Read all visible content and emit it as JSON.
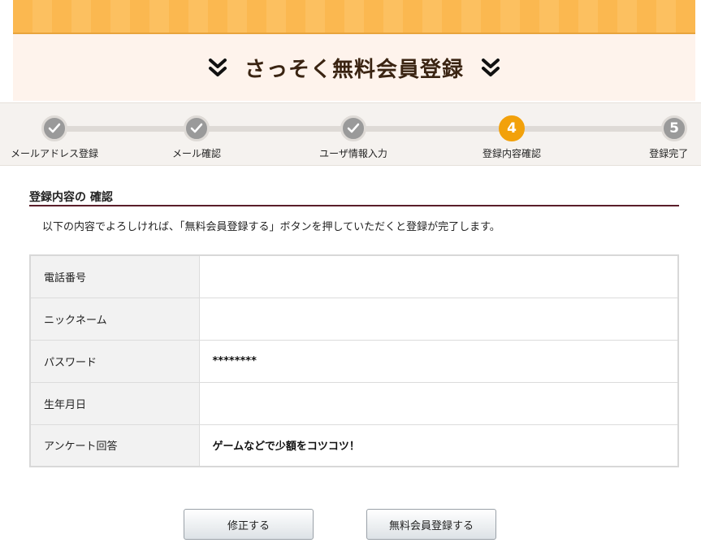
{
  "header": {
    "title": "さっそく無料会員登録",
    "chevron_icon": "double-chevron-down-icon"
  },
  "steps": [
    {
      "number": "1",
      "label": "メールアドレス登録",
      "state": "done"
    },
    {
      "number": "2",
      "label": "メール確認",
      "state": "done"
    },
    {
      "number": "3",
      "label": "ユーザ情報入力",
      "state": "done"
    },
    {
      "number": "4",
      "label": "登録内容確認",
      "state": "current"
    },
    {
      "number": "5",
      "label": "登録完了",
      "state": "todo"
    }
  ],
  "section": {
    "heading": "登録内容の 確認",
    "intro": "以下の内容でよろしければ、「無料会員登録する」ボタンを押していただくと登録が完了します。"
  },
  "table": {
    "rows": [
      {
        "label": "電話番号",
        "value": ""
      },
      {
        "label": "ニックネーム",
        "value": ""
      },
      {
        "label": "パスワード",
        "value": "********"
      },
      {
        "label": "生年月日",
        "value": ""
      },
      {
        "label": "アンケート回答",
        "value": "ゲームなどで少額をコツコツ！"
      }
    ]
  },
  "buttons": {
    "edit_label": "修正する",
    "register_label": "無料会員登録する"
  },
  "colors": {
    "accent_orange": "#f2a10b",
    "banner_orange": "#fbb850",
    "heading_rule": "#5a1e2a"
  }
}
